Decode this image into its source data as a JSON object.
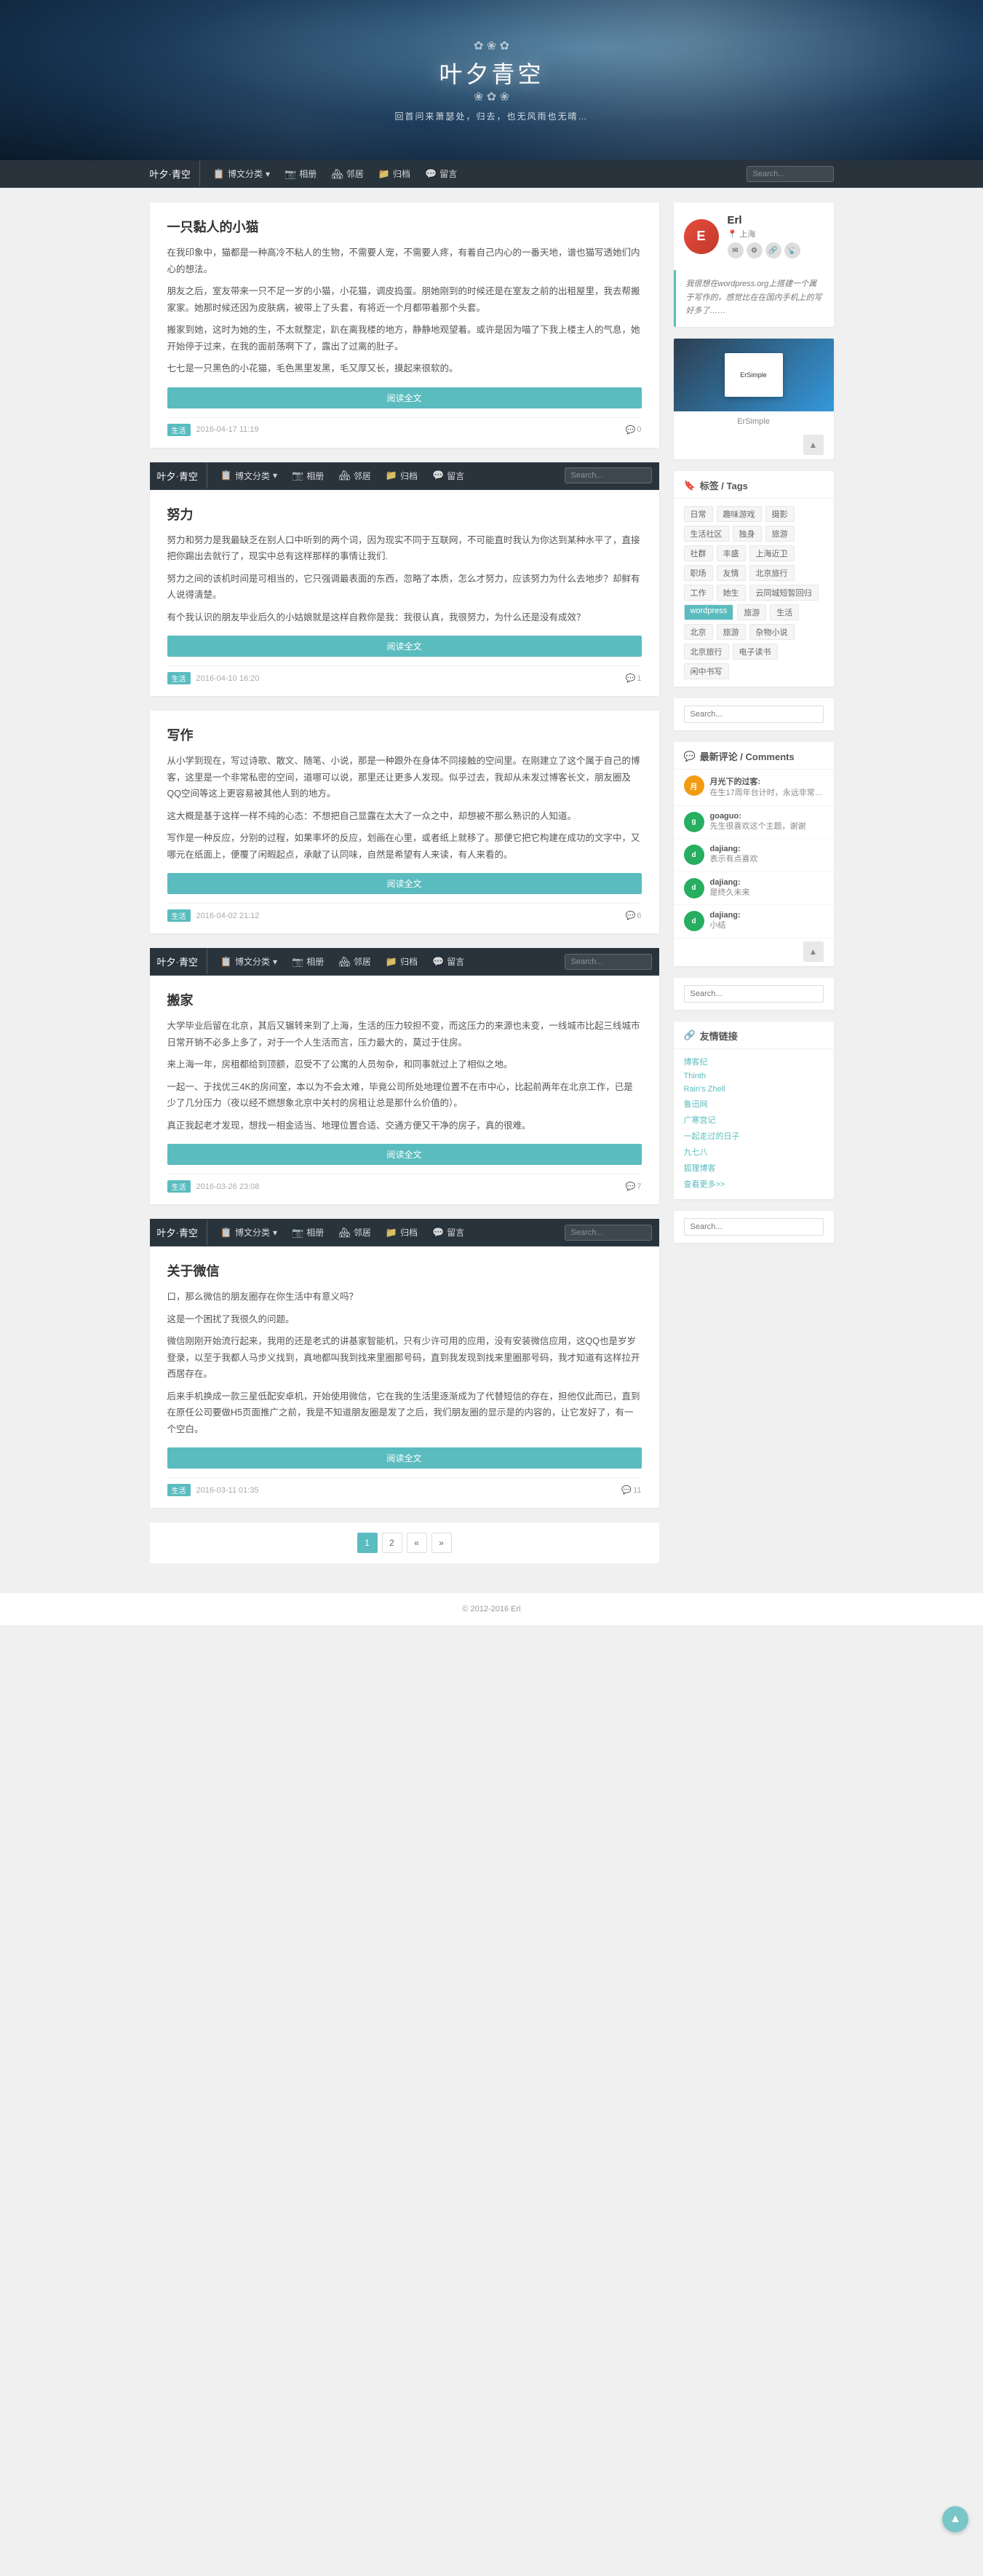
{
  "site": {
    "name": "叶夕青空",
    "tagline": "回首问来萧瑟处，归去，也无风雨也无晴…",
    "logo_text": "叶夕青空",
    "copyright": "© 2012-2016  Erl"
  },
  "nav": {
    "logo": "叶夕·青空",
    "items": [
      {
        "label": "博文分类",
        "icon": "📋",
        "has_dropdown": true
      },
      {
        "label": "相册",
        "icon": "📷"
      },
      {
        "label": "邻居",
        "icon": "🏘"
      },
      {
        "label": "归档",
        "icon": "📁"
      },
      {
        "label": "留言",
        "icon": "💬"
      }
    ],
    "search_placeholder": "Search..."
  },
  "posts": [
    {
      "title": "一只黏人的小猫",
      "content": [
        "在我印象中，猫都是一种高冷不粘人的生物，不需要人宠，不需要人疼，有着自己内心的一番天地，谱也猫写透她们内心的想法。",
        "朋友之后，室友带来一只不足一岁的小猫，小花猫，调皮捣蛋。朋她刚到的时候还是在室友之前的出租屋里，我去帮搬家家。她那时候还因为皮肤病，被带上了头套，有将近一个月都带着那个头套。",
        "搬家到她，这时为她的生，不太就整定，趴在离我楼的地方，静静地观望着。或许是因为喵了下我上楼主人的气息，她开始停于过来，在我的面前荡啊下了，露出了过离的肚子。",
        "七七是一只黑色的小花猫，毛色黑里发黑，毛又厚又长，摸起来很软的。"
      ],
      "read_more": "阅读全文",
      "category": "生活",
      "date": "2016-04-17 11:19",
      "comments": 0
    },
    {
      "title": "努力",
      "content": [
        "努力和努力是我最缺乏在别人口中听到的两个词，因为现实不同于互联网，不可能直时我认为你达到某种水平了，直接把你踢出去就行了，现实中总有这样那样的事情让我们.",
        "努力之间的该机时间是可相当的，它只强调最表面的东西，忽略了本质，怎么才努力，应该努力为什么去地步？却鲜有人说得清楚。",
        "有个我认识的朋友毕业后久的小姑娘就是这样自救你是我：我很认真，我很努力，为什么还是没有成效？"
      ],
      "read_more": "阅读全文",
      "category": "生活",
      "date": "2016-04-10 16:20",
      "comments": 1
    },
    {
      "title": "写作",
      "content": [
        "从小学到现在，写过诗歌、散文、随笔、小说，那是一种跟外在身体不同接触的空间里。在刚建立了这个属于自己的博客，这里是一个非常私密的空间，道哪可以说，那里还让更多人发现。似乎过去，我却从未发过博客长文，朋友圈及QQ空间等这上更容易被其他人到的地方。",
        "这大概是基于这样一样不纯的心态：不想把自己显露在太大了一众之中，却想被不那么熟识的人知道。",
        "写作是一种反应，分别的过程，如果率坏的反应，划画在心里，或者纸上就移了。那便它把它构建在成功的文字中，又哪元在纸面上，便覆了闲暇起点，承献了认同味，自然是希望有人来读，有人来看的。"
      ],
      "read_more": "阅读全文",
      "category": "生活",
      "date": "2016-04-02 21:12",
      "comments": 6
    },
    {
      "title": "搬家",
      "content": [
        "大学毕业后留在北京，其后又辗转来到了上海，生活的压力较担不变，而这压力的来源也未变，一线城市比起三线城市日常开销不必多上多了，对于一个人生活而言，压力最大的，莫过于住房。",
        "来上海一年，房租都给到顶额，忍受不了公寓的人员匆杂，和同事就过上了相似之地。",
        "一起一、于找优三4K的房间室，本以为不会太难，毕竟公司所处地理位置不在市中心，比起前两年在北京工作，已是少了几分压力（夜以经不燃想象北京中关村的房租让总是那什么价值的）。",
        "真正我起老才发现，想找一相金适当、地理位置合适、交通方便又干净的房子，真的很难。"
      ],
      "read_more": "阅读全文",
      "category": "生活",
      "date": "2016-03-26 23:08",
      "comments": 7
    },
    {
      "title": "关于微信",
      "content": [
        "口，那么微信的朋友圈存在你生活中有意义吗？",
        "这是一个困扰了我很久的问题。",
        "微信刚刚开始流行起来，我用的还是老式的讲基家智能机，只有少许可用的应用，没有安装微信应用，这QQ也是岁岁登录，以至于我都人马步义找到，真地都叫我到找来里圈那号码，直到我发现到找来里圈那号码，我才知道有这样拉开西居存在。",
        "后来手机换成一款三星低配安卓机，开始使用微信，它在我的生活里逐渐成为了代替短信的存在，担他仅此而已，直到在原任公司要做H5页面推广之前，我是不知道朋友圈是发了之后，我们朋友圈的显示是的内容的，让它发好了，有一个空白。"
      ],
      "read_more": "阅读全文",
      "category": "生活",
      "date": "2016-03-11 01:35",
      "comments": 11
    }
  ],
  "sidebar": {
    "author": {
      "name": "Erl",
      "location": "上海",
      "avatar_initial": "E",
      "links": [
        "✉",
        "⚙",
        "🔗",
        "📡"
      ]
    },
    "quote": "我很想在wordpress.org上搭建一个属于写作的，感觉比在在国内手机上的写好多了……",
    "preview_label": "ErSimple",
    "tags_title": "标签 / Tags",
    "tags": [
      {
        "label": "日常",
        "highlighted": false
      },
      {
        "label": "趣味游戏",
        "highlighted": false
      },
      {
        "label": "摄影",
        "highlighted": false
      },
      {
        "label": "生活社区",
        "highlighted": false
      },
      {
        "label": "独身",
        "highlighted": false
      },
      {
        "label": "旅游",
        "highlighted": false
      },
      {
        "label": "社群",
        "highlighted": false
      },
      {
        "label": "丰盛",
        "highlighted": false
      },
      {
        "label": "上海近卫",
        "highlighted": false
      },
      {
        "label": "职场",
        "highlighted": false
      },
      {
        "label": "友情",
        "highlighted": false
      },
      {
        "label": "北京旅行",
        "highlighted": false
      },
      {
        "label": "工作",
        "highlighted": false
      },
      {
        "label": "她生",
        "highlighted": false
      },
      {
        "label": "云同城短暂回归",
        "highlighted": false
      },
      {
        "label": "wordpress",
        "highlighted": false
      },
      {
        "label": "旅游",
        "highlighted": false
      },
      {
        "label": "生活",
        "highlighted": false
      },
      {
        "label": "北京",
        "highlighted": false
      },
      {
        "label": "旅游",
        "highlighted": false
      },
      {
        "label": "杂物小说",
        "highlighted": false
      },
      {
        "label": "北京旅行",
        "highlighted": false
      },
      {
        "label": "电子读书",
        "highlighted": false
      },
      {
        "label": "闲中书写",
        "highlighted": false
      }
    ],
    "search_placeholder": "Search...",
    "comments_title": "最新评论 / Comments",
    "comments": [
      {
        "author": "月光下的过客:",
        "text": "在生17周年台计时，永远非常…",
        "avatar_color": "#f39c12",
        "initial": "月"
      },
      {
        "author": "goaguo:",
        "text": "先生很喜欢这个主题，谢谢",
        "avatar_color": "#27ae60",
        "initial": "g"
      },
      {
        "author": "dajiang:",
        "text": "表示有点喜欢",
        "avatar_color": "#27ae60",
        "initial": "d"
      },
      {
        "author": "dajiang:",
        "text": "是终久未来",
        "avatar_color": "#27ae60",
        "initial": "d"
      },
      {
        "author": "dajiang:",
        "text": "小结",
        "avatar_color": "#27ae60",
        "initial": "d"
      }
    ],
    "links_title": "友情链接",
    "links": [
      "博客纪",
      "Thinth",
      "Rain's Zhell",
      "鲁迅网",
      "广寒宫记",
      "一起走过的日子",
      "九七八",
      "狐狸博客",
      "查看更多>>"
    ]
  },
  "pagination": {
    "pages": [
      "1",
      "2",
      "«",
      "»"
    ]
  }
}
